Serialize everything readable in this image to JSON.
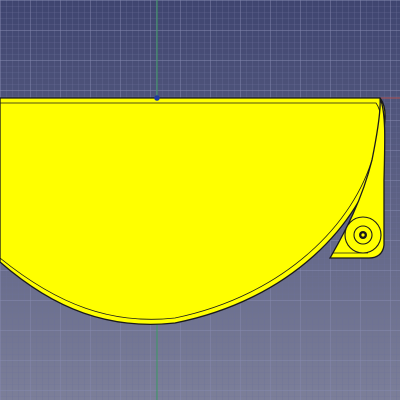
{
  "viewport": {
    "background_top": "#3f4570",
    "background_bottom": "#7c7f99",
    "grid_minor": "#6b7099",
    "grid_major": "#868ab0",
    "axis_horizontal_color": "#b05050",
    "axis_vertical_color": "#3c9a62"
  },
  "part": {
    "name": "sketch-face",
    "fill_color": "#ffff00",
    "edge_color": "#1a1a1a",
    "vertex_color": "#1f3aa0"
  }
}
